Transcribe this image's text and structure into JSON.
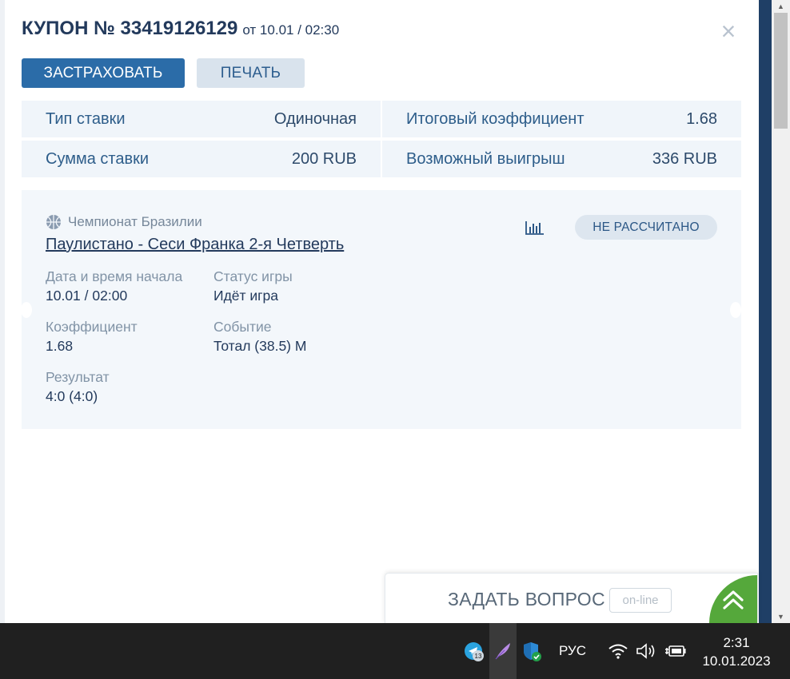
{
  "coupon": {
    "title": "КУПОН № 33419126129",
    "date": "от 10.01 / 02:30",
    "close_icon": "close-icon",
    "insure_label": "ЗАСТРАХОВАТЬ",
    "print_label": "ПЕЧАТЬ"
  },
  "summary": {
    "bet_type_label": "Тип ставки",
    "bet_type_value": "Одиночная",
    "total_coef_label": "Итоговый коэффициент",
    "total_coef_value": "1.68",
    "stake_label": "Сумма ставки",
    "stake_value": "200 RUB",
    "win_label": "Возможный выигрыш",
    "win_value": "336 RUB"
  },
  "event": {
    "league_icon": "basketball-icon",
    "league": "Чемпионат Бразилии",
    "match": "Паулистано - Сеси Франка 2-я Четверть",
    "stats_icon": "bar-chart-icon",
    "status_badge": "НЕ РАССЧИТАНО",
    "start_label": "Дата и время начала",
    "start_value": "10.01 / 02:00",
    "game_status_label": "Статус игры",
    "game_status_value": "Идёт игра",
    "coef_label": "Коэффициент",
    "coef_value": "1.68",
    "outcome_label": "Событие",
    "outcome_value": "Тотал (38.5) М",
    "result_label": "Результат",
    "result_value": "4:0 (4:0)"
  },
  "ask": {
    "label": "ЗАДАТЬ ВОПРОС",
    "online": "on-line",
    "icon": "double-chevron-up-icon"
  },
  "taskbar": {
    "telegram_badge": "13",
    "lang": "РУС",
    "time": "2:31",
    "date": "10.01.2023"
  },
  "colors": {
    "brand_blue": "#2b6ca8",
    "title_navy": "#233a5c",
    "card_bg": "#f3f7fb",
    "online_green": "#55a83b",
    "taskbar": "#202020"
  }
}
